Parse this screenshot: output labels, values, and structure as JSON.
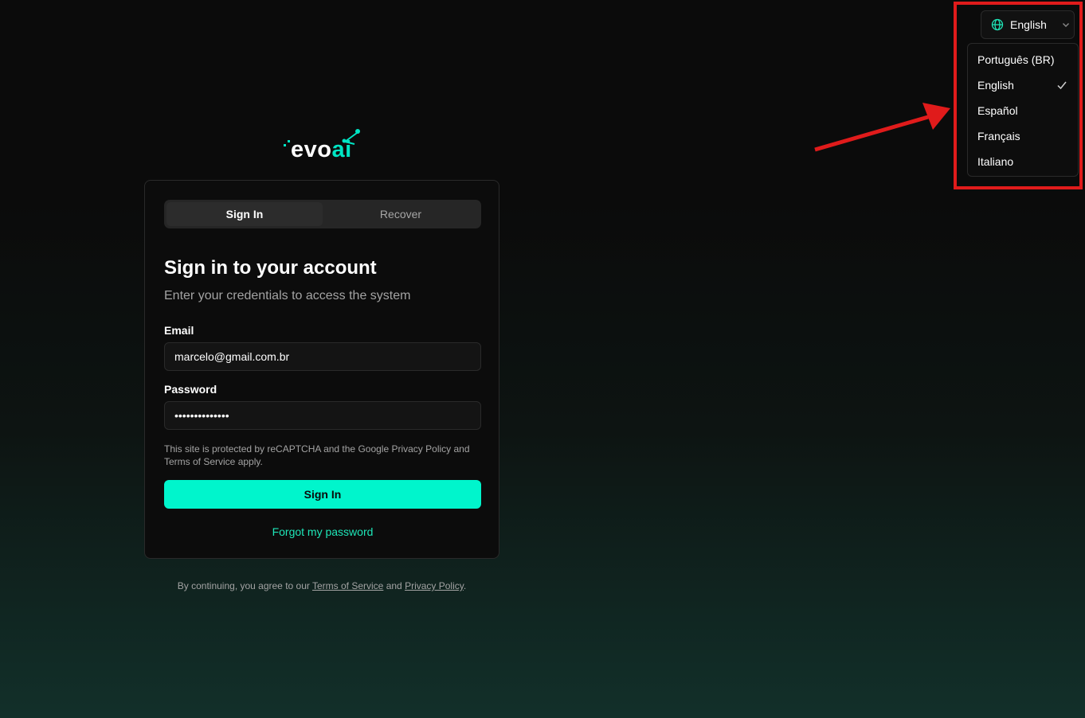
{
  "brand": {
    "logo_evo": "evo",
    "logo_ai": "ai",
    "accent": "#00f5cc"
  },
  "auth": {
    "tabs": [
      {
        "label": "Sign In",
        "active": true
      },
      {
        "label": "Recover",
        "active": false
      }
    ],
    "title": "Sign in to your account",
    "subtitle": "Enter your credentials to access the system",
    "email": {
      "label": "Email",
      "value": "marcelo@gmail.com.br"
    },
    "password": {
      "label": "Password",
      "value": "••••••••••••••"
    },
    "recaptcha_notice": "This site is protected by reCAPTCHA and the Google Privacy Policy and Terms of Service apply.",
    "submit_label": "Sign In",
    "forgot_label": "Forgot my password"
  },
  "legal": {
    "prefix": "By continuing, you agree to our",
    "terms": "Terms of Service",
    "and": "and",
    "privacy": "Privacy Policy",
    "suffix": "."
  },
  "language": {
    "current": "English",
    "options": [
      {
        "label": "Português (BR)",
        "selected": false
      },
      {
        "label": "English",
        "selected": true
      },
      {
        "label": "Español",
        "selected": false
      },
      {
        "label": "Français",
        "selected": false
      },
      {
        "label": "Italiano",
        "selected": false
      }
    ]
  },
  "icons": {
    "language": "globe-icon",
    "dropdown": "chevron-down-icon",
    "selected": "check-icon"
  },
  "annotation": {
    "color": "#e01b1b"
  }
}
